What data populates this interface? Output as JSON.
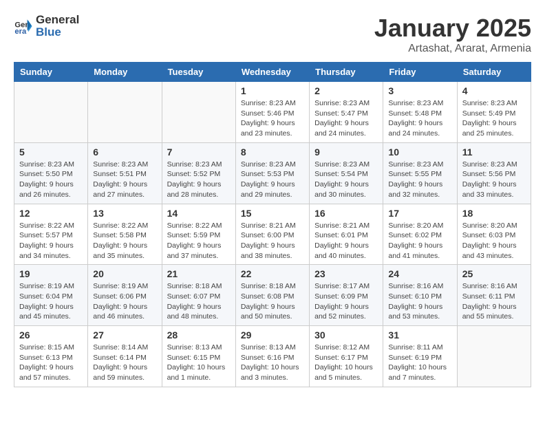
{
  "logo": {
    "general": "General",
    "blue": "Blue"
  },
  "header": {
    "title": "January 2025",
    "subtitle": "Artashat, Ararat, Armenia"
  },
  "weekdays": [
    "Sunday",
    "Monday",
    "Tuesday",
    "Wednesday",
    "Thursday",
    "Friday",
    "Saturday"
  ],
  "weeks": [
    [
      {
        "day": "",
        "sunrise": "",
        "sunset": "",
        "daylight": ""
      },
      {
        "day": "",
        "sunrise": "",
        "sunset": "",
        "daylight": ""
      },
      {
        "day": "",
        "sunrise": "",
        "sunset": "",
        "daylight": ""
      },
      {
        "day": "1",
        "sunrise": "Sunrise: 8:23 AM",
        "sunset": "Sunset: 5:46 PM",
        "daylight": "Daylight: 9 hours and 23 minutes."
      },
      {
        "day": "2",
        "sunrise": "Sunrise: 8:23 AM",
        "sunset": "Sunset: 5:47 PM",
        "daylight": "Daylight: 9 hours and 24 minutes."
      },
      {
        "day": "3",
        "sunrise": "Sunrise: 8:23 AM",
        "sunset": "Sunset: 5:48 PM",
        "daylight": "Daylight: 9 hours and 24 minutes."
      },
      {
        "day": "4",
        "sunrise": "Sunrise: 8:23 AM",
        "sunset": "Sunset: 5:49 PM",
        "daylight": "Daylight: 9 hours and 25 minutes."
      }
    ],
    [
      {
        "day": "5",
        "sunrise": "Sunrise: 8:23 AM",
        "sunset": "Sunset: 5:50 PM",
        "daylight": "Daylight: 9 hours and 26 minutes."
      },
      {
        "day": "6",
        "sunrise": "Sunrise: 8:23 AM",
        "sunset": "Sunset: 5:51 PM",
        "daylight": "Daylight: 9 hours and 27 minutes."
      },
      {
        "day": "7",
        "sunrise": "Sunrise: 8:23 AM",
        "sunset": "Sunset: 5:52 PM",
        "daylight": "Daylight: 9 hours and 28 minutes."
      },
      {
        "day": "8",
        "sunrise": "Sunrise: 8:23 AM",
        "sunset": "Sunset: 5:53 PM",
        "daylight": "Daylight: 9 hours and 29 minutes."
      },
      {
        "day": "9",
        "sunrise": "Sunrise: 8:23 AM",
        "sunset": "Sunset: 5:54 PM",
        "daylight": "Daylight: 9 hours and 30 minutes."
      },
      {
        "day": "10",
        "sunrise": "Sunrise: 8:23 AM",
        "sunset": "Sunset: 5:55 PM",
        "daylight": "Daylight: 9 hours and 32 minutes."
      },
      {
        "day": "11",
        "sunrise": "Sunrise: 8:23 AM",
        "sunset": "Sunset: 5:56 PM",
        "daylight": "Daylight: 9 hours and 33 minutes."
      }
    ],
    [
      {
        "day": "12",
        "sunrise": "Sunrise: 8:22 AM",
        "sunset": "Sunset: 5:57 PM",
        "daylight": "Daylight: 9 hours and 34 minutes."
      },
      {
        "day": "13",
        "sunrise": "Sunrise: 8:22 AM",
        "sunset": "Sunset: 5:58 PM",
        "daylight": "Daylight: 9 hours and 35 minutes."
      },
      {
        "day": "14",
        "sunrise": "Sunrise: 8:22 AM",
        "sunset": "Sunset: 5:59 PM",
        "daylight": "Daylight: 9 hours and 37 minutes."
      },
      {
        "day": "15",
        "sunrise": "Sunrise: 8:21 AM",
        "sunset": "Sunset: 6:00 PM",
        "daylight": "Daylight: 9 hours and 38 minutes."
      },
      {
        "day": "16",
        "sunrise": "Sunrise: 8:21 AM",
        "sunset": "Sunset: 6:01 PM",
        "daylight": "Daylight: 9 hours and 40 minutes."
      },
      {
        "day": "17",
        "sunrise": "Sunrise: 8:20 AM",
        "sunset": "Sunset: 6:02 PM",
        "daylight": "Daylight: 9 hours and 41 minutes."
      },
      {
        "day": "18",
        "sunrise": "Sunrise: 8:20 AM",
        "sunset": "Sunset: 6:03 PM",
        "daylight": "Daylight: 9 hours and 43 minutes."
      }
    ],
    [
      {
        "day": "19",
        "sunrise": "Sunrise: 8:19 AM",
        "sunset": "Sunset: 6:04 PM",
        "daylight": "Daylight: 9 hours and 45 minutes."
      },
      {
        "day": "20",
        "sunrise": "Sunrise: 8:19 AM",
        "sunset": "Sunset: 6:06 PM",
        "daylight": "Daylight: 9 hours and 46 minutes."
      },
      {
        "day": "21",
        "sunrise": "Sunrise: 8:18 AM",
        "sunset": "Sunset: 6:07 PM",
        "daylight": "Daylight: 9 hours and 48 minutes."
      },
      {
        "day": "22",
        "sunrise": "Sunrise: 8:18 AM",
        "sunset": "Sunset: 6:08 PM",
        "daylight": "Daylight: 9 hours and 50 minutes."
      },
      {
        "day": "23",
        "sunrise": "Sunrise: 8:17 AM",
        "sunset": "Sunset: 6:09 PM",
        "daylight": "Daylight: 9 hours and 52 minutes."
      },
      {
        "day": "24",
        "sunrise": "Sunrise: 8:16 AM",
        "sunset": "Sunset: 6:10 PM",
        "daylight": "Daylight: 9 hours and 53 minutes."
      },
      {
        "day": "25",
        "sunrise": "Sunrise: 8:16 AM",
        "sunset": "Sunset: 6:11 PM",
        "daylight": "Daylight: 9 hours and 55 minutes."
      }
    ],
    [
      {
        "day": "26",
        "sunrise": "Sunrise: 8:15 AM",
        "sunset": "Sunset: 6:13 PM",
        "daylight": "Daylight: 9 hours and 57 minutes."
      },
      {
        "day": "27",
        "sunrise": "Sunrise: 8:14 AM",
        "sunset": "Sunset: 6:14 PM",
        "daylight": "Daylight: 9 hours and 59 minutes."
      },
      {
        "day": "28",
        "sunrise": "Sunrise: 8:13 AM",
        "sunset": "Sunset: 6:15 PM",
        "daylight": "Daylight: 10 hours and 1 minute."
      },
      {
        "day": "29",
        "sunrise": "Sunrise: 8:13 AM",
        "sunset": "Sunset: 6:16 PM",
        "daylight": "Daylight: 10 hours and 3 minutes."
      },
      {
        "day": "30",
        "sunrise": "Sunrise: 8:12 AM",
        "sunset": "Sunset: 6:17 PM",
        "daylight": "Daylight: 10 hours and 5 minutes."
      },
      {
        "day": "31",
        "sunrise": "Sunrise: 8:11 AM",
        "sunset": "Sunset: 6:19 PM",
        "daylight": "Daylight: 10 hours and 7 minutes."
      },
      {
        "day": "",
        "sunrise": "",
        "sunset": "",
        "daylight": ""
      }
    ]
  ]
}
